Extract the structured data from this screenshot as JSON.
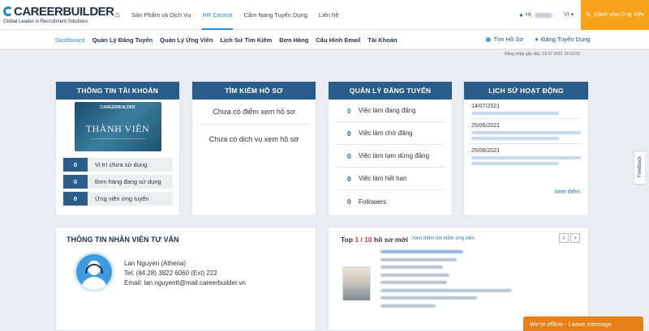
{
  "brand": {
    "logo": "CAREERBUILDER",
    "tagline": "Global Leader in Recruitment Solutions"
  },
  "topnav": {
    "items": [
      "Sản Phẩm và Dịch Vụ",
      "HR Central",
      "Cẩm Nang Tuyển Dụng",
      "Liên hệ"
    ],
    "greeting": "Hi,",
    "language": "VI",
    "candidate_button": "Dành cho Ứng Viên"
  },
  "subnav": {
    "items": [
      "Dashboard",
      "Quản Lý Đăng Tuyển",
      "Quản Lý Ứng Viên",
      "Lịch Sử Tìm Kiếm",
      "Đơn Hàng",
      "Cấu Hình Email",
      "Tài Khoản"
    ],
    "search_profiles": "Tìm Hồ Sơ",
    "post_job": "Đăng Tuyển Dụng"
  },
  "last_login": "Đăng nhập gần đây: 23-07-2021 18:19:53",
  "account": {
    "title": "THÔNG TIN TÀI KHOẢN",
    "card_logo": "CAREERBUILDER",
    "card_label": "THÀNH VIÊN",
    "stats": [
      {
        "value": "0",
        "label": "Vị trí chưa sử dụng"
      },
      {
        "value": "0",
        "label": "Đơn hàng đang sử dụng"
      },
      {
        "value": "0",
        "label": "Ứng viên ứng tuyển"
      }
    ]
  },
  "search": {
    "title": "TÌM KIẾM HỒ SƠ",
    "lines": [
      "Chưa có điểm xem hồ sơ",
      "Chưa có dịch vụ xem hồ sơ"
    ]
  },
  "jobs": {
    "title": "QUẢN LÝ ĐĂNG TUYỂN",
    "rows": [
      {
        "value": "0",
        "label": "Việc làm đang đăng"
      },
      {
        "value": "0",
        "label": "Việc làm chờ đăng"
      },
      {
        "value": "0",
        "label": "Việc làm tạm dừng đăng"
      },
      {
        "value": "0",
        "label": "Việc làm hết hạn"
      },
      {
        "value": "0",
        "label": "Followers"
      }
    ]
  },
  "history": {
    "title": "LỊCH SỬ HOẠT ĐỘNG",
    "dates": [
      "14/07/2021",
      "25/06/2021",
      "25/06/2021"
    ],
    "more": "Xem thêm"
  },
  "consultant": {
    "title": "THÔNG TIN NHÂN VIÊN TƯ VẤN",
    "name": "Lan Nguyen (Athena)",
    "phone": "Tel: (84.28) 3822 6060 (Ext) 222",
    "email": "Email: lan.nguyentt@mail.careerbuilder.vn"
  },
  "top_profiles": {
    "title_prefix": "Top",
    "current": "1",
    "separator": " / ",
    "total": "10",
    "title_suffix": "hồ sơ mới",
    "link": "Xem thêm tìm kiếm ứng viên",
    "prev": "‹",
    "next": "›"
  },
  "feedback": "Feedback",
  "chat": "We're offline - Leave message"
}
